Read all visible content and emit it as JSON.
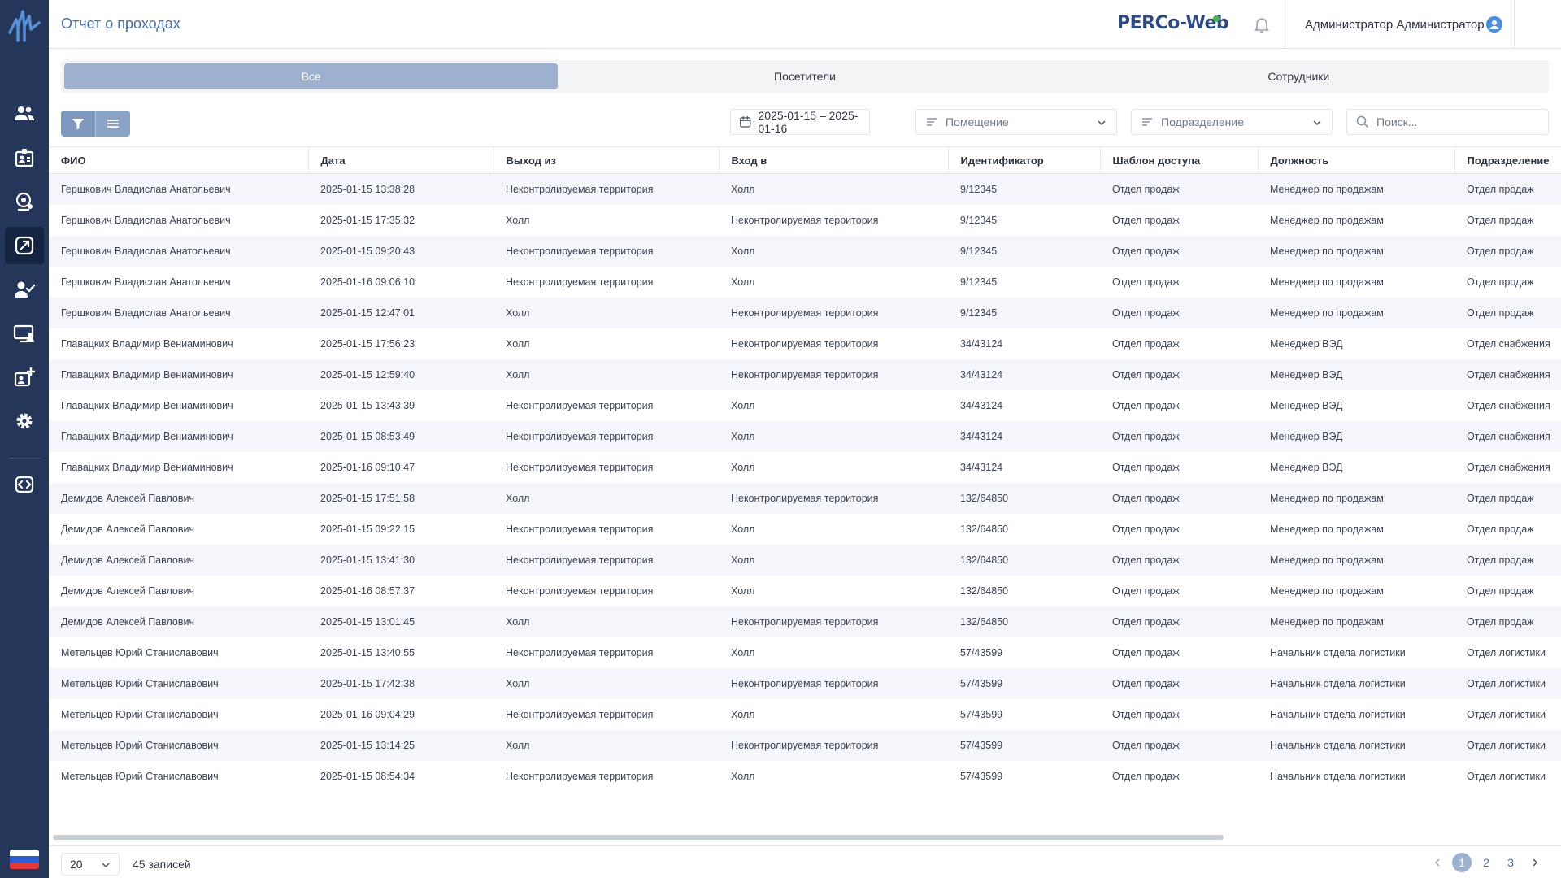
{
  "header": {
    "title": "Отчет о проходах",
    "brand": "PERCo-Web",
    "user": "Администратор Администратор",
    "help": "?"
  },
  "sidebar": {
    "items": [
      "users-icon",
      "badge-icon",
      "monitoring-icon",
      "access-report-icon",
      "user-check-icon",
      "visitors-icon",
      "add-employee-icon",
      "settings-icon",
      "code-icon"
    ],
    "active": "access-report-icon",
    "language": "ru"
  },
  "tabs": [
    {
      "label": "Все",
      "active": true
    },
    {
      "label": "Посетители",
      "active": false
    },
    {
      "label": "Сотрудники",
      "active": false
    }
  ],
  "filters": {
    "date_range": "2025-01-15 – 2025-01-16",
    "room_placeholder": "Помещение",
    "division_placeholder": "Подразделение",
    "search_placeholder": "Поиск..."
  },
  "table": {
    "columns": [
      "ФИО",
      "Дата",
      "Выход из",
      "Вход в",
      "Идентификатор",
      "Шаблон доступа",
      "Должность",
      "Подразделение"
    ],
    "rows": [
      [
        "Гершкович Владислав Анатольевич",
        "2025-01-15 13:38:28",
        "Неконтролируемая территория",
        "Холл",
        "9/12345",
        "Отдел продаж",
        "Менеджер по продажам",
        "Отдел продаж"
      ],
      [
        "Гершкович Владислав Анатольевич",
        "2025-01-15 17:35:32",
        "Холл",
        "Неконтролируемая территория",
        "9/12345",
        "Отдел продаж",
        "Менеджер по продажам",
        "Отдел продаж"
      ],
      [
        "Гершкович Владислав Анатольевич",
        "2025-01-15 09:20:43",
        "Неконтролируемая территория",
        "Холл",
        "9/12345",
        "Отдел продаж",
        "Менеджер по продажам",
        "Отдел продаж"
      ],
      [
        "Гершкович Владислав Анатольевич",
        "2025-01-16 09:06:10",
        "Неконтролируемая территория",
        "Холл",
        "9/12345",
        "Отдел продаж",
        "Менеджер по продажам",
        "Отдел продаж"
      ],
      [
        "Гершкович Владислав Анатольевич",
        "2025-01-15 12:47:01",
        "Холл",
        "Неконтролируемая территория",
        "9/12345",
        "Отдел продаж",
        "Менеджер по продажам",
        "Отдел продаж"
      ],
      [
        "Главацких Владимир Вениаминович",
        "2025-01-15 17:56:23",
        "Холл",
        "Неконтролируемая территория",
        "34/43124",
        "Отдел продаж",
        "Менеджер ВЭД",
        "Отдел снабжения"
      ],
      [
        "Главацких Владимир Вениаминович",
        "2025-01-15 12:59:40",
        "Холл",
        "Неконтролируемая территория",
        "34/43124",
        "Отдел продаж",
        "Менеджер ВЭД",
        "Отдел снабжения"
      ],
      [
        "Главацких Владимир Вениаминович",
        "2025-01-15 13:43:39",
        "Неконтролируемая территория",
        "Холл",
        "34/43124",
        "Отдел продаж",
        "Менеджер ВЭД",
        "Отдел снабжения"
      ],
      [
        "Главацких Владимир Вениаминович",
        "2025-01-15 08:53:49",
        "Неконтролируемая территория",
        "Холл",
        "34/43124",
        "Отдел продаж",
        "Менеджер ВЭД",
        "Отдел снабжения"
      ],
      [
        "Главацких Владимир Вениаминович",
        "2025-01-16 09:10:47",
        "Неконтролируемая территория",
        "Холл",
        "34/43124",
        "Отдел продаж",
        "Менеджер ВЭД",
        "Отдел снабжения"
      ],
      [
        "Демидов Алексей Павлович",
        "2025-01-15 17:51:58",
        "Холл",
        "Неконтролируемая территория",
        "132/64850",
        "Отдел продаж",
        "Менеджер по продажам",
        "Отдел продаж"
      ],
      [
        "Демидов Алексей Павлович",
        "2025-01-15 09:22:15",
        "Неконтролируемая территория",
        "Холл",
        "132/64850",
        "Отдел продаж",
        "Менеджер по продажам",
        "Отдел продаж"
      ],
      [
        "Демидов Алексей Павлович",
        "2025-01-15 13:41:30",
        "Неконтролируемая территория",
        "Холл",
        "132/64850",
        "Отдел продаж",
        "Менеджер по продажам",
        "Отдел продаж"
      ],
      [
        "Демидов Алексей Павлович",
        "2025-01-16 08:57:37",
        "Неконтролируемая территория",
        "Холл",
        "132/64850",
        "Отдел продаж",
        "Менеджер по продажам",
        "Отдел продаж"
      ],
      [
        "Демидов Алексей Павлович",
        "2025-01-15 13:01:45",
        "Холл",
        "Неконтролируемая территория",
        "132/64850",
        "Отдел продаж",
        "Менеджер по продажам",
        "Отдел продаж"
      ],
      [
        "Метельцев Юрий Станиславович",
        "2025-01-15 13:40:55",
        "Неконтролируемая территория",
        "Холл",
        "57/43599",
        "Отдел продаж",
        "Начальник отдела логистики",
        "Отдел логистики"
      ],
      [
        "Метельцев Юрий Станиславович",
        "2025-01-15 17:42:38",
        "Холл",
        "Неконтролируемая территория",
        "57/43599",
        "Отдел продаж",
        "Начальник отдела логистики",
        "Отдел логистики"
      ],
      [
        "Метельцев Юрий Станиславович",
        "2025-01-16 09:04:29",
        "Неконтролируемая территория",
        "Холл",
        "57/43599",
        "Отдел продаж",
        "Начальник отдела логистики",
        "Отдел логистики"
      ],
      [
        "Метельцев Юрий Станиславович",
        "2025-01-15 13:14:25",
        "Холл",
        "Неконтролируемая территория",
        "57/43599",
        "Отдел продаж",
        "Начальник отдела логистики",
        "Отдел логистики"
      ],
      [
        "Метельцев Юрий Станиславович",
        "2025-01-15 08:54:34",
        "Неконтролируемая территория",
        "Холл",
        "57/43599",
        "Отдел продаж",
        "Начальник отдела логистики",
        "Отдел логистики"
      ]
    ]
  },
  "footer": {
    "page_size": "20",
    "records": "45 записей",
    "pages": [
      "1",
      "2",
      "3"
    ],
    "current_page": "1"
  },
  "colors": {
    "sidebar": "#24365a",
    "accent": "#9db0cf",
    "title": "#4a6e9e"
  }
}
